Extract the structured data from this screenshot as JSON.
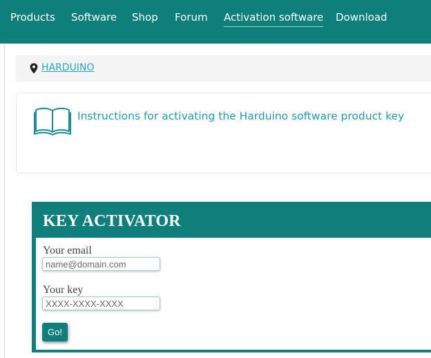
{
  "nav": {
    "items": [
      {
        "label": "Products"
      },
      {
        "label": "Software"
      },
      {
        "label": "Shop"
      },
      {
        "label": "Forum"
      },
      {
        "label": "Activation software",
        "active": true
      },
      {
        "label": "Download"
      }
    ]
  },
  "breadcrumb": {
    "icon": "map-pin-icon",
    "link": "HARDUINO"
  },
  "info_card": {
    "icon": "open-book-icon",
    "title": "Instructions for activating the Harduino software product key"
  },
  "activator": {
    "title": "KEY ACTIVATOR",
    "email_label": "Your email",
    "email_placeholder": "name@domain.com",
    "key_label": "Your key",
    "key_placeholder": "XXXX-XXXX-XXXX",
    "submit_label": "Go!"
  },
  "colors": {
    "brand": "#0f7f7c",
    "link": "#2aa5c4",
    "card_title": "#1e9bb5"
  }
}
